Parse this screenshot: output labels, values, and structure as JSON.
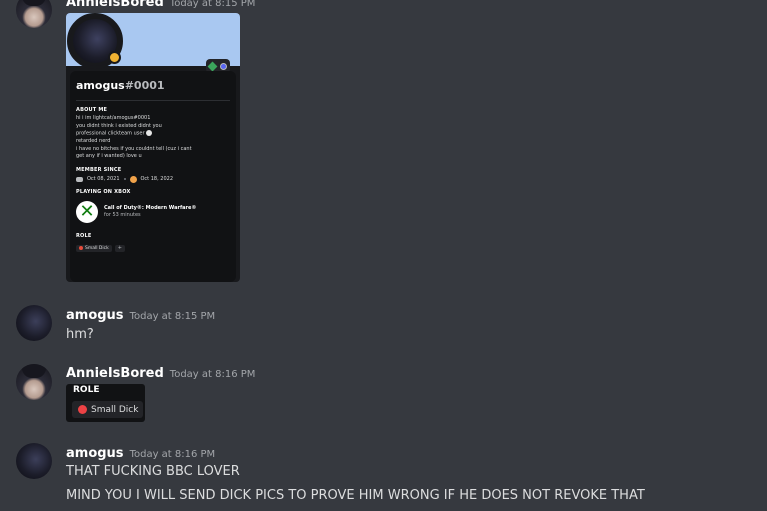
{
  "messages": [
    {
      "username": "AnnieIsBored",
      "timestamp": "Today at 8:15 PM"
    },
    {
      "username": "amogus",
      "timestamp": "Today at 8:15 PM",
      "lines": [
        "hm?"
      ]
    },
    {
      "username": "AnnieIsBored",
      "timestamp": "Today at 8:16 PM"
    },
    {
      "username": "amogus",
      "timestamp": "Today at 8:16 PM",
      "lines": [
        "THAT FUCKING BBC LOVER",
        "MIND YOU I WILL SEND DICK PICS TO PROVE HIM WRONG IF HE DOES NOT REVOKE THAT"
      ]
    }
  ],
  "profile_screenshot": {
    "username": "amogus",
    "discriminator": "#0001",
    "about_heading": "ABOUT ME",
    "about_lines": [
      "hi i im lightcat/amogus#0001",
      "you didnt think i existed didnt you",
      "professional clickteam user",
      "retarded nerd",
      "i have no bitches if you couldnt tell (cuz i cant",
      "get any if i wanted) love u"
    ],
    "member_since_heading": "MEMBER SINCE",
    "discord_date": "Oct 08, 2021",
    "server_date": "Oct 18, 2022",
    "playing_heading": "PLAYING ON XBOX",
    "game_title": "Call of Duty®: Modern Warfare®",
    "game_time": "for 53 minutes",
    "role_heading": "ROLE",
    "role_name": "Small Dick",
    "add_role": "+",
    "status_color": "#f0b232",
    "banner_color": "#a9c8f1"
  },
  "role_embed": {
    "heading": "ROLE",
    "role_name": "Small Dick",
    "role_color": "#ed4245"
  }
}
